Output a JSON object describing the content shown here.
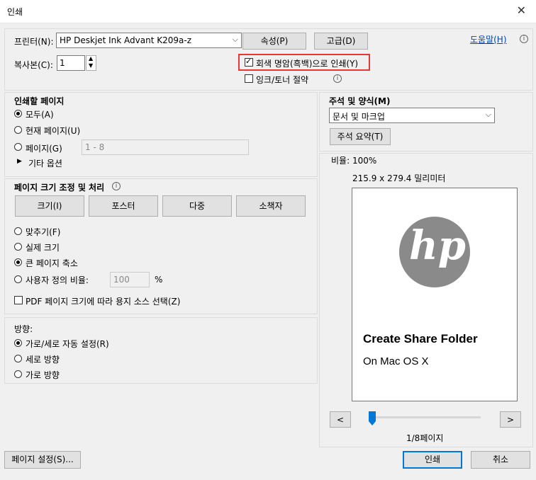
{
  "window": {
    "title": "인쇄",
    "close_symbol": "✕"
  },
  "printer": {
    "label": "프린터(N):",
    "selected": "HP Deskjet Ink Advant K209a-z",
    "properties_btn": "속성(P)",
    "advanced_btn": "고급(D)",
    "help_link": "도움말(H)",
    "copies_label": "복사본(C):",
    "copies_value": "1",
    "grayscale_label": "회색 명암(흑백)으로 인쇄(Y)",
    "grayscale_checked": true,
    "ink_save_label": "잉크/토너 절약",
    "ink_save_checked": false
  },
  "pages_to_print": {
    "heading": "인쇄할 페이지",
    "options": [
      "모두(A)",
      "현재 페이지(U)",
      "페이지(G)"
    ],
    "selected_index": 0,
    "page_range_placeholder": "1 - 8",
    "more_options": "기타 옵션"
  },
  "page_sizing": {
    "heading": "페이지 크기 조정 및 처리",
    "tabs": [
      "크기(I)",
      "포스터",
      "다중",
      "소책자"
    ],
    "options": [
      "맞추기(F)",
      "실제 크기",
      "큰 페이지 축소",
      "사용자 정의 비율:"
    ],
    "selected_index": 2,
    "custom_scale_value": "100",
    "percent_sign": "%",
    "pdf_source_label": "PDF 페이지 크기에 따라 용지 소스 선택(Z)",
    "pdf_source_checked": false
  },
  "orientation": {
    "heading": "방향:",
    "options": [
      "가로/세로 자동 설정(R)",
      "세로 방향",
      "가로 방향"
    ],
    "selected_index": 0
  },
  "comments_forms": {
    "heading": "주석 및 양식(M)",
    "selected": "문서 및 마크업",
    "summary_btn": "주석 요약(T)"
  },
  "preview": {
    "scale_label": "비율: 100%",
    "page_size": "215.9 x 279.4 밀리미터",
    "logo_text": "hp",
    "doc_title": "Create Share Folder",
    "doc_subtitle": "On Mac OS X",
    "prev_btn": "<",
    "next_btn": ">",
    "page_indicator": "1/8페이지",
    "slider_position": 0.0
  },
  "footer": {
    "page_setup_btn": "페이지 설정(S)...",
    "print_btn": "인쇄",
    "cancel_btn": "취소"
  },
  "colors": {
    "highlight_box": "#e53935",
    "accent": "#0078d7",
    "logo_gray": "#8a8a8a",
    "slider_thumb": "#0078d7"
  }
}
